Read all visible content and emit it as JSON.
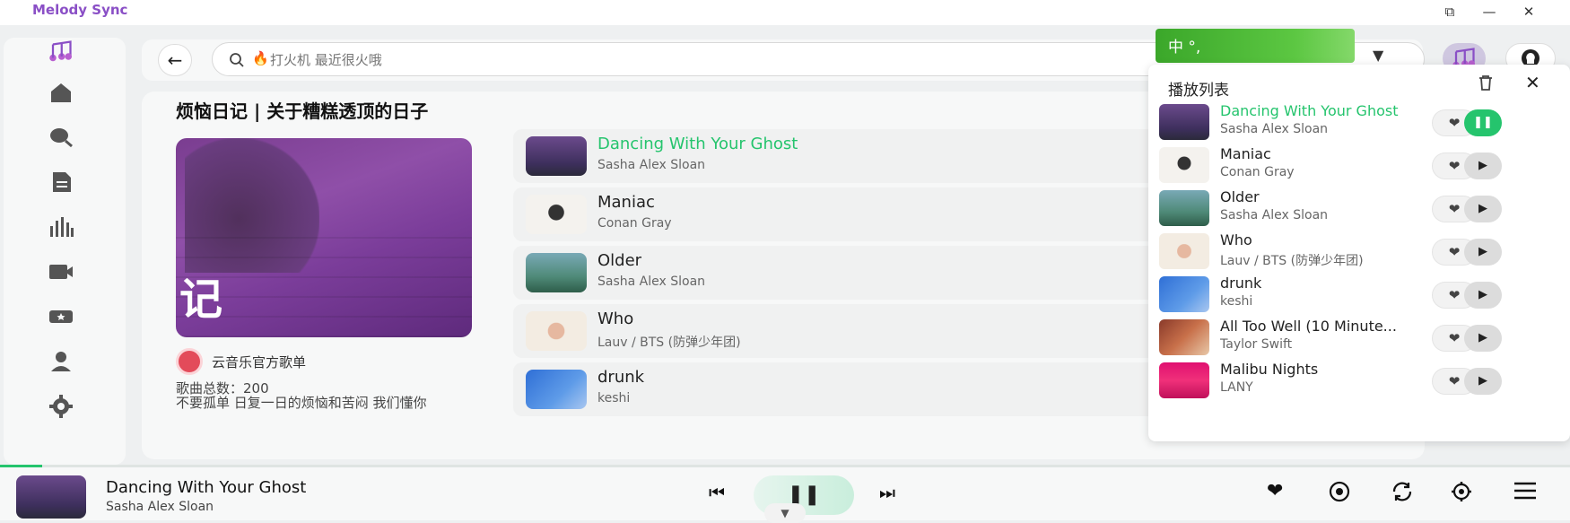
{
  "app": {
    "title": "Melody Sync"
  },
  "window_controls": {
    "pip": "⧉",
    "minimize": "—",
    "close": "✕"
  },
  "search": {
    "placeholder": "打火机 最近很火哦",
    "back": "←"
  },
  "ime": {
    "label": "中 °,"
  },
  "dropdown": {
    "arrow": "▼"
  },
  "playlist": {
    "title": "烦恼日记 | 关于糟糕透顶的日子",
    "cover_char": "记",
    "creator": "云音乐官方歌单",
    "count_label": "歌曲总数：",
    "count": "200",
    "description": "不要孤单 日复一日的烦恼和苦闷 我们懂你"
  },
  "songs": [
    {
      "title": "Dancing With Your Ghost",
      "artist": "Sasha Alex Sloan",
      "active": true
    },
    {
      "title": "Maniac",
      "artist": "Conan Gray"
    },
    {
      "title": "Older",
      "artist": "Sasha Alex Sloan"
    },
    {
      "title": "Who",
      "artist": "Lauv / BTS (防弹少年团)"
    },
    {
      "title": "drunk",
      "artist": "keshi"
    }
  ],
  "queue": {
    "title": "播放列表",
    "items": [
      {
        "title": "Dancing With Your Ghost",
        "artist": "Sasha Alex Sloan",
        "active": true
      },
      {
        "title": "Maniac",
        "artist": "Conan Gray"
      },
      {
        "title": "Older",
        "artist": "Sasha Alex Sloan"
      },
      {
        "title": "Who",
        "artist": "Lauv / BTS (防弹少年团)"
      },
      {
        "title": "drunk",
        "artist": "keshi"
      },
      {
        "title": "All Too Well (10 Minute...",
        "artist": "Taylor Swift"
      },
      {
        "title": "Malibu Nights",
        "artist": "LANY"
      }
    ]
  },
  "player": {
    "title": "Dancing With Your Ghost",
    "artist": "Sasha Alex Sloan",
    "progress_fraction": 0.027
  },
  "colors": {
    "accent": "#25c46d",
    "brand": "#8a4fc6"
  },
  "icons": {
    "sidebar": [
      "home-icon",
      "search-icon",
      "file-icon",
      "chart-icon",
      "video-icon",
      "ticket-icon",
      "user-icon",
      "gear-icon"
    ]
  }
}
